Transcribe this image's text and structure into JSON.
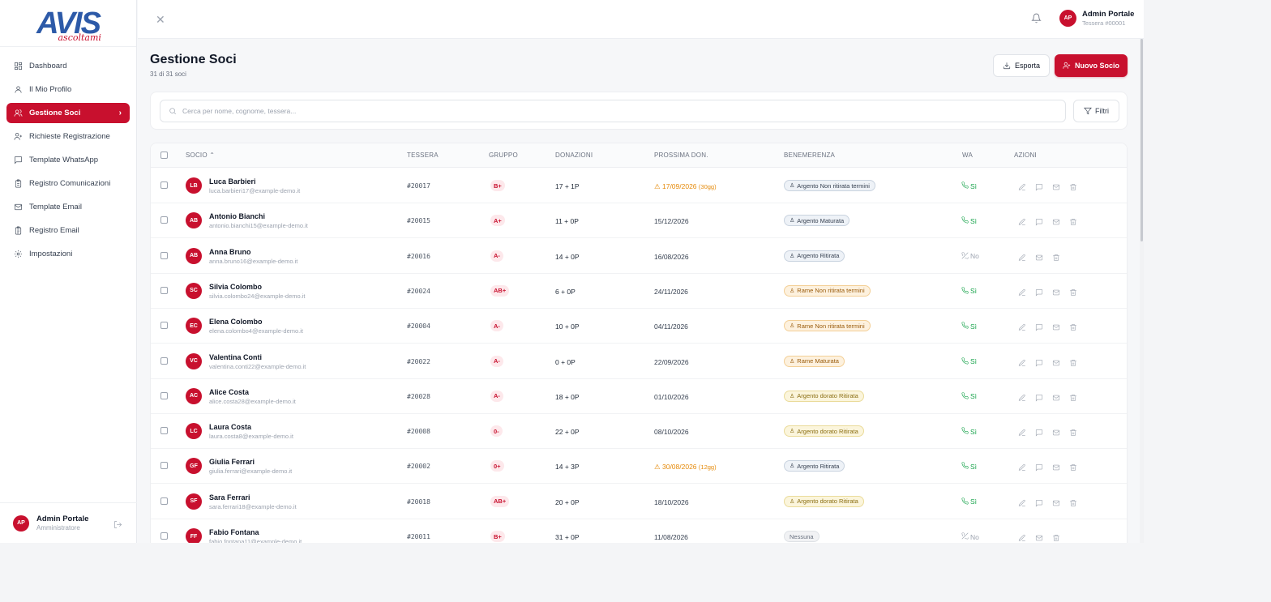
{
  "brand": {
    "logo_text": "AVIS",
    "logo_sub": "ascoltami",
    "accent": "#c8102e",
    "logo_color": "#2d5aa8"
  },
  "sidebar": {
    "items": [
      {
        "label": "Dashboard",
        "icon": "layout-dashboard-icon",
        "active": false
      },
      {
        "label": "Il Mio Profilo",
        "icon": "user-icon",
        "active": false
      },
      {
        "label": "Gestione Soci",
        "icon": "users-icon",
        "active": true
      },
      {
        "label": "Richieste Registrazione",
        "icon": "user-plus-icon",
        "active": false
      },
      {
        "label": "Template WhatsApp",
        "icon": "message-square-icon",
        "active": false
      },
      {
        "label": "Registro Comunicazioni",
        "icon": "clipboard-icon",
        "active": false
      },
      {
        "label": "Template Email",
        "icon": "mail-icon",
        "active": false
      },
      {
        "label": "Registro Email",
        "icon": "clipboard-list-icon",
        "active": false
      },
      {
        "label": "Impostazioni",
        "icon": "gear-icon",
        "active": false
      }
    ],
    "footer": {
      "initials": "AP",
      "name": "Admin Portale",
      "role": "Amministratore"
    }
  },
  "topbar": {
    "initials": "AP",
    "user_name": "Admin Portale",
    "user_sub": "Tessera #00001"
  },
  "page": {
    "title": "Gestione Soci",
    "count": "31 di 31 soci",
    "export_label": "Esporta",
    "new_label": "Nuovo Socio",
    "search_placeholder": "Cerca per nome, cognome, tessera...",
    "filter_label": "Filtri"
  },
  "table": {
    "columns": {
      "socio": "SOCIO ⌃",
      "tessera": "TESSERA",
      "gruppo": "GRUPPO",
      "donazioni": "DONAZIONI",
      "prossima": "PROSSIMA DON.",
      "benemerenza": "BENEMERENZA",
      "wa": "WA",
      "azioni": "AZIONI"
    },
    "rows": [
      {
        "initials": "LB",
        "name": "Luca Barbieri",
        "email": "luca.barbieri17@example-demo.it",
        "tessera": "#20017",
        "gruppo": "B+",
        "donazioni": "17 + 1P",
        "prossima": "17/09/2026",
        "prossima_days": "(30gg)",
        "warn": true,
        "benemerenza": "Argento Non ritirata termini",
        "ben_type": "argento",
        "wa": "Sì",
        "wa_ok": true
      },
      {
        "initials": "AB",
        "name": "Antonio Bianchi",
        "email": "antonio.bianchi15@example-demo.it",
        "tessera": "#20015",
        "gruppo": "A+",
        "donazioni": "11 + 0P",
        "prossima": "15/12/2026",
        "prossima_days": "",
        "warn": false,
        "benemerenza": "Argento Maturata",
        "ben_type": "argento",
        "wa": "Sì",
        "wa_ok": true
      },
      {
        "initials": "AB",
        "name": "Anna Bruno",
        "email": "anna.bruno16@example-demo.it",
        "tessera": "#20016",
        "gruppo": "A-",
        "donazioni": "14 + 0P",
        "prossima": "16/08/2026",
        "prossima_days": "",
        "warn": false,
        "benemerenza": "Argento Ritirata",
        "ben_type": "argento",
        "wa": "No",
        "wa_ok": false
      },
      {
        "initials": "SC",
        "name": "Silvia Colombo",
        "email": "silvia.colombo24@example-demo.it",
        "tessera": "#20024",
        "gruppo": "AB+",
        "donazioni": "6 + 0P",
        "prossima": "24/11/2026",
        "prossima_days": "",
        "warn": false,
        "benemerenza": "Rame Non ritirata termini",
        "ben_type": "rame",
        "wa": "Sì",
        "wa_ok": true
      },
      {
        "initials": "EC",
        "name": "Elena Colombo",
        "email": "elena.colombo4@example-demo.it",
        "tessera": "#20004",
        "gruppo": "A-",
        "donazioni": "10 + 0P",
        "prossima": "04/11/2026",
        "prossima_days": "",
        "warn": false,
        "benemerenza": "Rame Non ritirata termini",
        "ben_type": "rame",
        "wa": "Sì",
        "wa_ok": true
      },
      {
        "initials": "VC",
        "name": "Valentina Conti",
        "email": "valentina.conti22@example-demo.it",
        "tessera": "#20022",
        "gruppo": "A-",
        "donazioni": "0 + 0P",
        "prossima": "22/09/2026",
        "prossima_days": "",
        "warn": false,
        "benemerenza": "Rame Maturata",
        "ben_type": "rame",
        "wa": "Sì",
        "wa_ok": true
      },
      {
        "initials": "AC",
        "name": "Alice Costa",
        "email": "alice.costa28@example-demo.it",
        "tessera": "#20028",
        "gruppo": "A-",
        "donazioni": "18 + 0P",
        "prossima": "01/10/2026",
        "prossima_days": "",
        "warn": false,
        "benemerenza": "Argento dorato Ritirata",
        "ben_type": "dorato",
        "wa": "Sì",
        "wa_ok": true
      },
      {
        "initials": "LC",
        "name": "Laura Costa",
        "email": "laura.costa8@example-demo.it",
        "tessera": "#20008",
        "gruppo": "0-",
        "donazioni": "22 + 0P",
        "prossima": "08/10/2026",
        "prossima_days": "",
        "warn": false,
        "benemerenza": "Argento dorato Ritirata",
        "ben_type": "dorato",
        "wa": "Sì",
        "wa_ok": true
      },
      {
        "initials": "GF",
        "name": "Giulia Ferrari",
        "email": "giulia.ferrari@example-demo.it",
        "tessera": "#20002",
        "gruppo": "0+",
        "donazioni": "14 + 3P",
        "prossima": "30/08/2026",
        "prossima_days": "(12gg)",
        "warn": true,
        "benemerenza": "Argento Ritirata",
        "ben_type": "argento",
        "wa": "Sì",
        "wa_ok": true
      },
      {
        "initials": "SF",
        "name": "Sara Ferrari",
        "email": "sara.ferrari18@example-demo.it",
        "tessera": "#20018",
        "gruppo": "AB+",
        "donazioni": "20 + 0P",
        "prossima": "18/10/2026",
        "prossima_days": "",
        "warn": false,
        "benemerenza": "Argento dorato Ritirata",
        "ben_type": "dorato",
        "wa": "Sì",
        "wa_ok": true
      },
      {
        "initials": "FF",
        "name": "Fabio Fontana",
        "email": "fabio.fontana11@example-demo.it",
        "tessera": "#20011",
        "gruppo": "B+",
        "donazioni": "31 + 0P",
        "prossima": "11/08/2026",
        "prossima_days": "",
        "warn": false,
        "benemerenza": "Nessuna",
        "ben_type": "nessuna",
        "wa": "No",
        "wa_ok": false
      }
    ]
  }
}
